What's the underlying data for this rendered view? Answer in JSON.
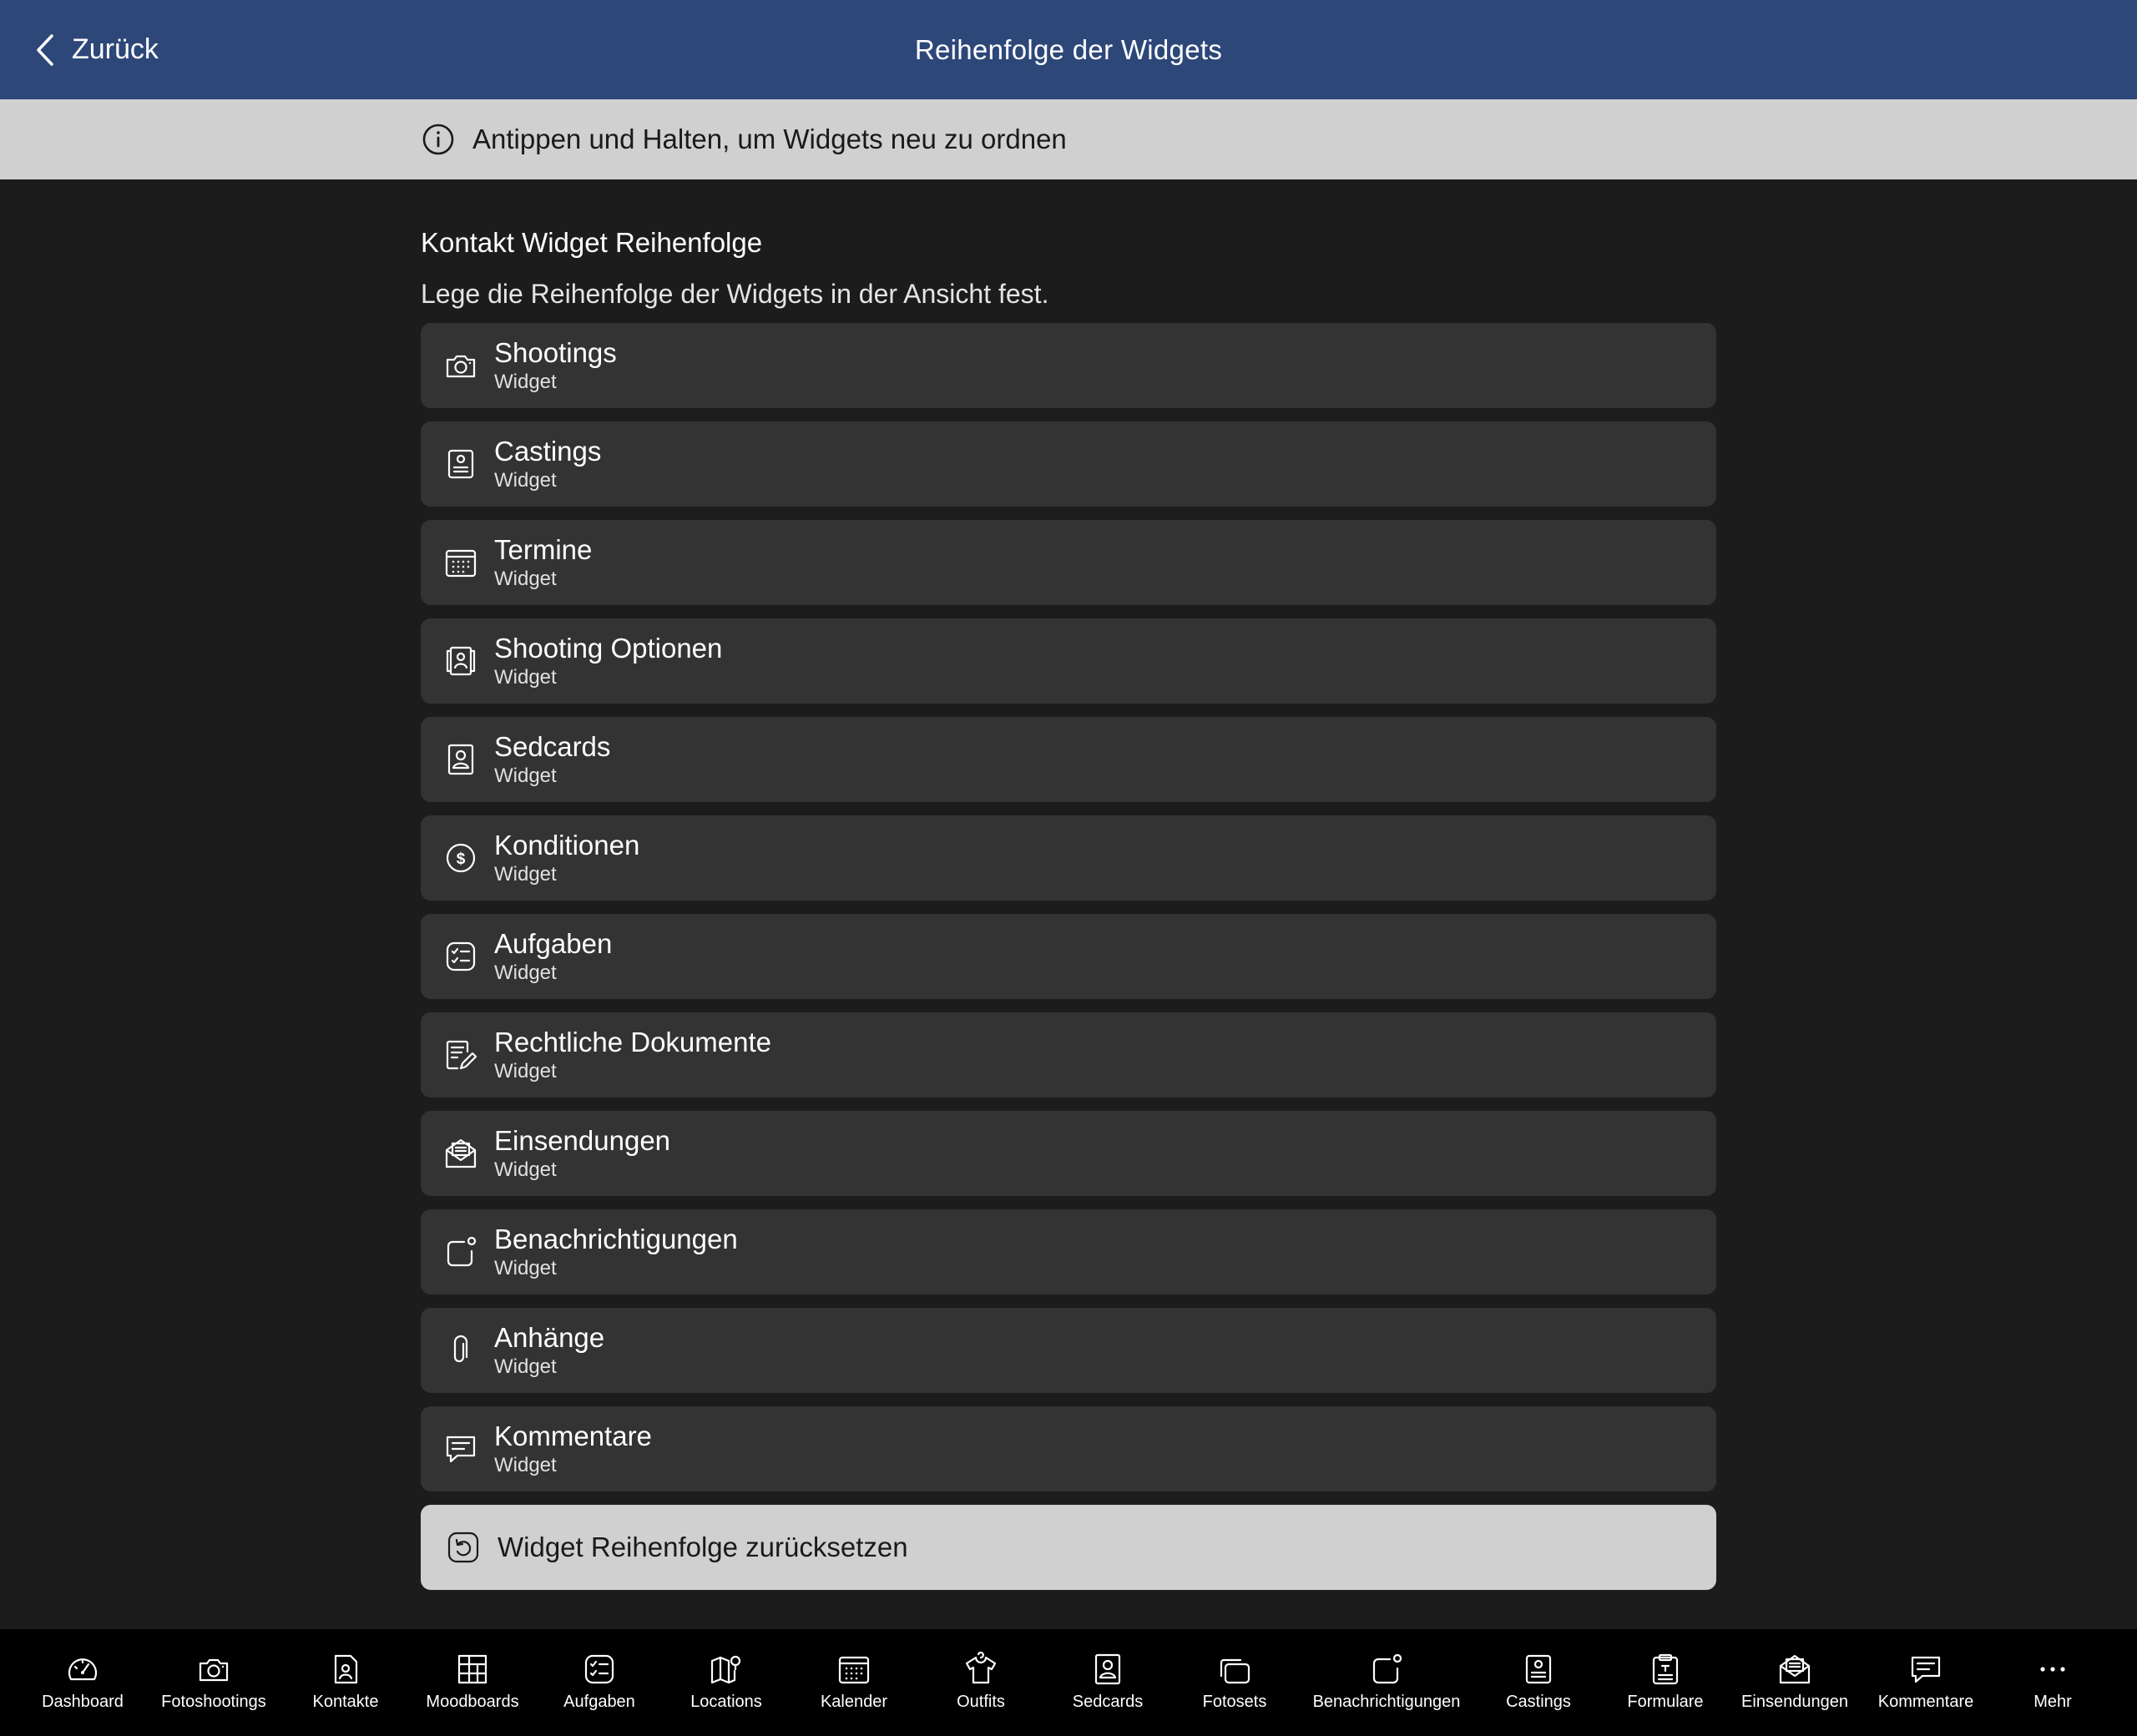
{
  "header": {
    "back_label": "Zurück",
    "title": "Reihenfolge der Widgets"
  },
  "info": {
    "text": "Antippen und Halten, um Widgets neu zu ordnen"
  },
  "section": {
    "title": "Kontakt Widget Reihenfolge",
    "description": "Lege die Reihenfolge der Widgets in der Ansicht fest."
  },
  "widgets": [
    {
      "title": "Shootings",
      "subtitle": "Widget",
      "icon": "camera-icon"
    },
    {
      "title": "Castings",
      "subtitle": "Widget",
      "icon": "casting-icon"
    },
    {
      "title": "Termine",
      "subtitle": "Widget",
      "icon": "calendar-icon"
    },
    {
      "title": "Shooting Optionen",
      "subtitle": "Widget",
      "icon": "shooting-options-icon"
    },
    {
      "title": "Sedcards",
      "subtitle": "Widget",
      "icon": "sedcard-icon"
    },
    {
      "title": "Konditionen",
      "subtitle": "Widget",
      "icon": "dollar-icon"
    },
    {
      "title": "Aufgaben",
      "subtitle": "Widget",
      "icon": "tasks-icon"
    },
    {
      "title": "Rechtliche Dokumente",
      "subtitle": "Widget",
      "icon": "document-edit-icon"
    },
    {
      "title": "Einsendungen",
      "subtitle": "Widget",
      "icon": "mail-open-icon"
    },
    {
      "title": "Benachrichtigungen",
      "subtitle": "Widget",
      "icon": "notification-icon"
    },
    {
      "title": "Anhänge",
      "subtitle": "Widget",
      "icon": "paperclip-icon"
    },
    {
      "title": "Kommentare",
      "subtitle": "Widget",
      "icon": "comment-icon"
    }
  ],
  "reset": {
    "label": "Widget Reihenfolge zurücksetzen"
  },
  "tabs": [
    {
      "label": "Dashboard",
      "icon": "dashboard-icon"
    },
    {
      "label": "Fotoshootings",
      "icon": "camera-icon"
    },
    {
      "label": "Kontakte",
      "icon": "contacts-icon"
    },
    {
      "label": "Moodboards",
      "icon": "moodboard-icon"
    },
    {
      "label": "Aufgaben",
      "icon": "tasks-icon"
    },
    {
      "label": "Locations",
      "icon": "map-icon"
    },
    {
      "label": "Kalender",
      "icon": "calendar-icon"
    },
    {
      "label": "Outfits",
      "icon": "shirt-icon"
    },
    {
      "label": "Sedcards",
      "icon": "sedcard-icon"
    },
    {
      "label": "Fotosets",
      "icon": "photosets-icon"
    },
    {
      "label": "Benachrichtigungen",
      "icon": "notification-icon"
    },
    {
      "label": "Castings",
      "icon": "casting-icon"
    },
    {
      "label": "Formulare",
      "icon": "clipboard-icon"
    },
    {
      "label": "Einsendungen",
      "icon": "mail-open-icon"
    },
    {
      "label": "Kommentare",
      "icon": "comment-icon"
    },
    {
      "label": "Mehr",
      "icon": "more-icon"
    }
  ]
}
